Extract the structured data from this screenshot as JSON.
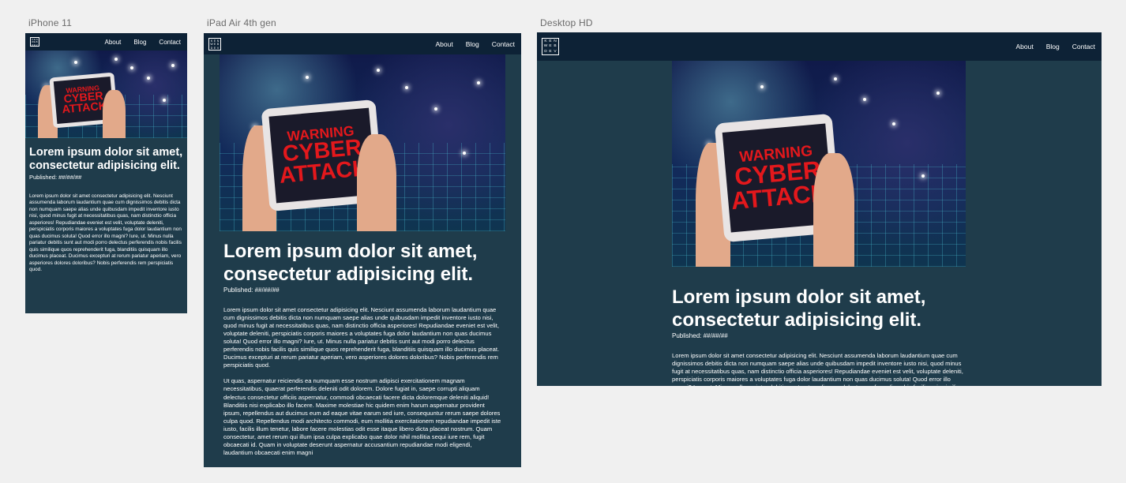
{
  "frames": [
    {
      "label": "iPhone 11"
    },
    {
      "label": "iPad Air 4th gen"
    },
    {
      "label": "Desktop HD"
    }
  ],
  "nav": {
    "logo": [
      "K",
      "E",
      "N",
      "W",
      "E",
      "B",
      "D",
      "E",
      "V"
    ],
    "logo_text": "KEN WEB DEV",
    "links": [
      "About",
      "Blog",
      "Contact"
    ]
  },
  "hero": {
    "image_text": [
      "WARNING",
      "CYBER",
      "ATTACK"
    ]
  },
  "article": {
    "title": "Lorem ipsum dolor sit amet, consectetur adipisicing elit.",
    "published": "Published: ##/##/##",
    "p1": "Lorem ipsum dolor sit amet consectetur adipisicing elit. Nesciunt assumenda laborum laudantium quae cum dignissimos debitis dicta non numquam saepe alias unde quibusdam impedit inventore iusto nisi, quod minus fugit at necessitatibus quas, nam distinctio officia asperiores! Repudiandae eveniet est velit, voluptate deleniti, perspiciatis corporis maiores a voluptates fuga dolor laudantium non quas ducimus soluta! Quod error illo magni? Iure, ut. Minus nulla pariatur debitis sunt aut modi porro delectus perferendis nobis facilis quis similique quos reprehenderit fuga, blanditiis quisquam illo ducimus placeat. Ducimus excepturi at rerum pariatur aperiam, vero asperiores dolores doloribus? Nobis perferendis rem perspiciatis quod.",
    "p2": "Ut quas, aspernatur reiciendis ea numquam esse nostrum adipisci exercitationem magnam necessitatibus, quaerat perferendis deleniti odit dolorem. Dolore fugiat in, saepe corrupti aliquam delectus consectetur officiis aspernatur, commodi obcaecati facere dicta doloremque deleniti aliquid! Blanditiis nisi explicabo illo facere. Maxime molestiae hic quidem enim harum aspernatur provident ipsum, repellendus aut ducimus eum ad eaque vitae earum sed iure, consequuntur rerum saepe dolores culpa quod. Repellendus modi architecto commodi, eum mollitia exercitationem repudiandae impedit iste iusto, facilis illum tenetur, labore facere molestias odit esse itaque libero dicta placeat nostrum. Quam consectetur, amet rerum qui illum ipsa culpa explicabo quae dolor nihil mollitia sequi iure rem, fugit obcaecati id. Quam in voluptate deserunt aspernatur accusantium repudiandae modi eligendi, laudantium obcaecati enim magni"
  },
  "colors": {
    "canvas": "#f0f0f0",
    "nav": "#0d2236",
    "page": "#1f3c4b",
    "warning": "#e3181c"
  }
}
